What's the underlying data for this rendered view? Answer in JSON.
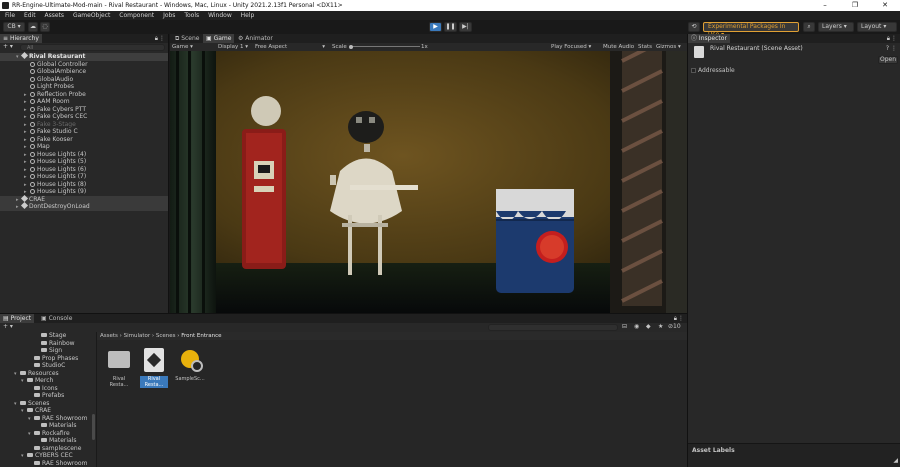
{
  "window": {
    "title": "RR-Engine-Ultimate-Mod-main - Rival Restaurant - Windows, Mac, Linux - Unity 2021.2.13f1 Personal <DX11>",
    "controls": [
      "–",
      "❐",
      "✕"
    ]
  },
  "menu": [
    "File",
    "Edit",
    "Assets",
    "GameObject",
    "Component",
    "Jobs",
    "Tools",
    "Window",
    "Help"
  ],
  "toolbar": {
    "account": "CB",
    "packages": "Experimental Packages In Use",
    "layers": "Layers",
    "layout": "Layout"
  },
  "hierarchy": {
    "tab": "Hierarchy",
    "search_placeholder": "All",
    "scene": "Rival Restaurant",
    "items": [
      {
        "label": "Global Controller",
        "indent": 1,
        "arrow": ""
      },
      {
        "label": "GlobalAmbience",
        "indent": 1,
        "arrow": ""
      },
      {
        "label": "GlobalAudio",
        "indent": 1,
        "arrow": ""
      },
      {
        "label": "Light Probes",
        "indent": 1,
        "arrow": ""
      },
      {
        "label": "Reflection Probe",
        "indent": 1,
        "arrow": "▸"
      },
      {
        "label": "AAM Room",
        "indent": 1,
        "arrow": "▸"
      },
      {
        "label": "Fake Cybers PTT",
        "indent": 1,
        "arrow": "▸"
      },
      {
        "label": "Fake Cybers CEC",
        "indent": 1,
        "arrow": "▸"
      },
      {
        "label": "Fake 3-Stage",
        "indent": 1,
        "arrow": "▸",
        "dim": true
      },
      {
        "label": "Fake Studio C",
        "indent": 1,
        "arrow": "▸"
      },
      {
        "label": "Fake Kooser",
        "indent": 1,
        "arrow": "▸"
      },
      {
        "label": "Map",
        "indent": 1,
        "arrow": "▸"
      },
      {
        "label": "House Lights (4)",
        "indent": 1,
        "arrow": "▸"
      },
      {
        "label": "House Lights (5)",
        "indent": 1,
        "arrow": "▸"
      },
      {
        "label": "House Lights (6)",
        "indent": 1,
        "arrow": "▸"
      },
      {
        "label": "House Lights (7)",
        "indent": 1,
        "arrow": "▸"
      },
      {
        "label": "House Lights (8)",
        "indent": 1,
        "arrow": "▸"
      },
      {
        "label": "House Lights (9)",
        "indent": 1,
        "arrow": "▸"
      }
    ],
    "scenes": [
      "CRAE",
      "DontDestroyOnLoad"
    ]
  },
  "view": {
    "tabs": [
      "Scene",
      "Game",
      "Animator"
    ],
    "game_dropdown": "Game",
    "display": "Display 1",
    "aspect": "Free Aspect",
    "scale_label": "Scale",
    "scale_value": "1x",
    "play_focused": "Play Focused",
    "mute": "Mute Audio",
    "stats": "Stats",
    "gizmos": "Gizmos"
  },
  "inspector": {
    "tab": "Inspector",
    "asset_title": "Rival Restaurant (Scene Asset)",
    "open": "Open",
    "addressable": "Addressable",
    "asset_labels": "Asset Labels"
  },
  "project": {
    "tabs": [
      "Project",
      "Console"
    ],
    "tree": [
      {
        "label": "Stage",
        "indent": 3
      },
      {
        "label": "Rainbow",
        "indent": 3
      },
      {
        "label": "Sign",
        "indent": 3
      },
      {
        "label": "Prop Phases",
        "indent": 2
      },
      {
        "label": "StudioC",
        "indent": 2
      },
      {
        "label": "Resources",
        "indent": 0,
        "arrow": "▾"
      },
      {
        "label": "Merch",
        "indent": 1,
        "arrow": "▾"
      },
      {
        "label": "Icons",
        "indent": 2
      },
      {
        "label": "Prefabs",
        "indent": 2
      },
      {
        "label": "Scenes",
        "indent": 0,
        "arrow": "▾"
      },
      {
        "label": "CRAE",
        "indent": 1,
        "arrow": "▾"
      },
      {
        "label": "RAE Showroom",
        "indent": 2,
        "arrow": "▾"
      },
      {
        "label": "Materials",
        "indent": 3
      },
      {
        "label": "Rockafire",
        "indent": 2,
        "arrow": "▾"
      },
      {
        "label": "Materials",
        "indent": 3
      },
      {
        "label": "samplescene",
        "indent": 2
      },
      {
        "label": "CYBERS CEC",
        "indent": 1,
        "arrow": "▾"
      },
      {
        "label": "RAE Showroom",
        "indent": 2
      },
      {
        "label": "StudioC",
        "indent": 2
      }
    ],
    "breadcrumb": [
      "Assets",
      "Simulator",
      "Scenes",
      "Front Entrance"
    ],
    "assets": [
      "Rival Resta...",
      "Rival Resta...",
      "SampleSc..."
    ],
    "count": "10"
  },
  "colors": {
    "accent": "#3a79bb",
    "packages": "#e0a034"
  }
}
